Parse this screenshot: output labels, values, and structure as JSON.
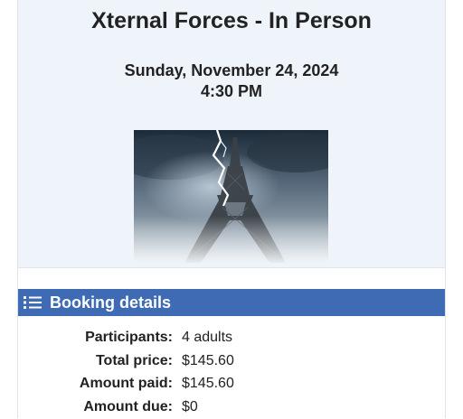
{
  "event": {
    "title": "Xternal Forces - In Person",
    "date": "Sunday, November 24, 2024",
    "time": "4:30 PM",
    "image_icon": "eiffel-tower-lightning-image"
  },
  "booking": {
    "section_title": "Booking details",
    "section_icon": "list-icon",
    "header_color": "#3e6bb4",
    "rows": [
      {
        "label": "Participants:",
        "value": "4 adults"
      },
      {
        "label": "Total price:",
        "value": "$145.60"
      },
      {
        "label": "Amount paid:",
        "value": "$145.60"
      },
      {
        "label": "Amount due:",
        "value": "$0"
      }
    ]
  }
}
